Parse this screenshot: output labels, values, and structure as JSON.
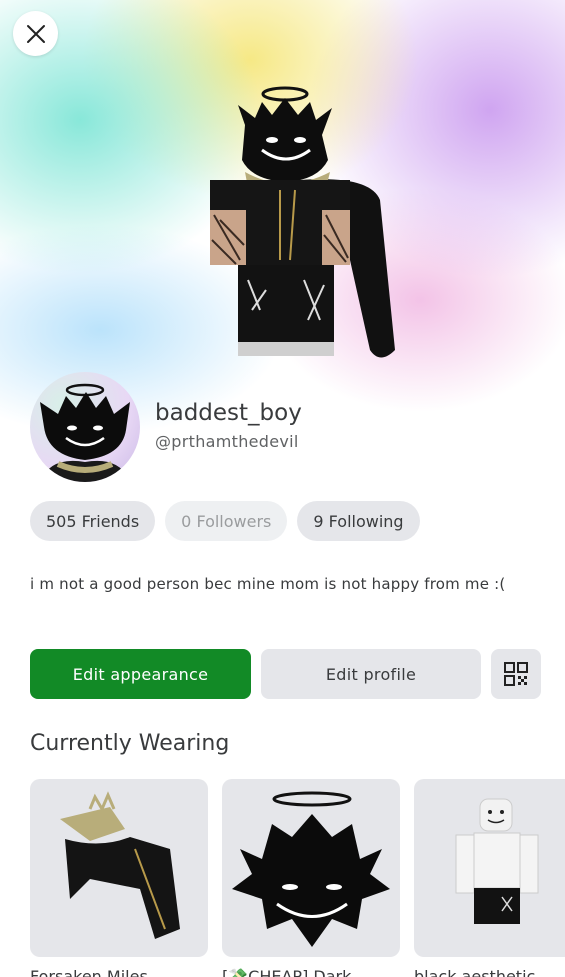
{
  "colors": {
    "accent": "#128a26",
    "pill_bg": "#e5e6ea",
    "text": "#393b3d"
  },
  "header": {
    "close_icon": "close-icon"
  },
  "profile": {
    "display_name": "baddest_boy",
    "username": "@prthamthedevil",
    "bio": "i m not a good person bec mine mom is not happy from me :("
  },
  "stats": {
    "friends": "505 Friends",
    "followers": "0 Followers",
    "following": "9 Following"
  },
  "actions": {
    "edit_appearance": "Edit appearance",
    "edit_profile": "Edit profile",
    "qr_icon": "qr-code-icon"
  },
  "currently_wearing": {
    "title": "Currently Wearing",
    "items": [
      {
        "name": "Forsaken Miles"
      },
      {
        "name": "[💸CHEAP] Dark"
      },
      {
        "name": "black aesthetic"
      }
    ]
  }
}
